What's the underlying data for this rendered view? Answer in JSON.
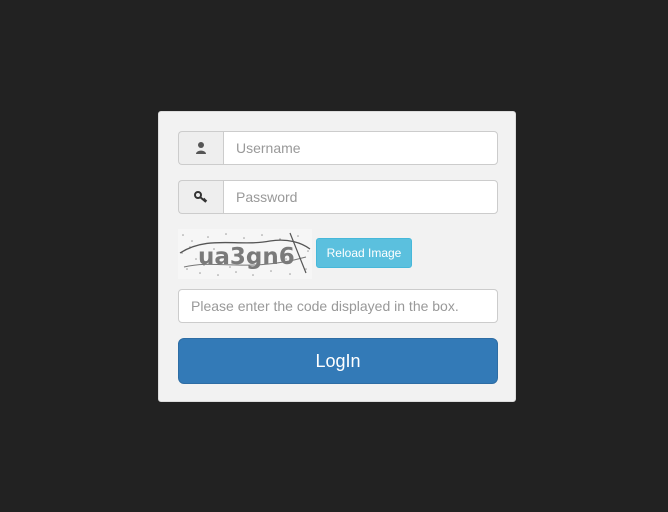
{
  "form": {
    "username_placeholder": "Username",
    "password_placeholder": "Password",
    "captcha_text": "ua3gn6",
    "reload_label": "Reload Image",
    "code_placeholder": "Please enter the code displayed in the box.",
    "login_label": "LogIn"
  },
  "icons": {
    "username": "user-icon",
    "password": "key-icon"
  },
  "colors": {
    "background": "#222222",
    "panel": "#f2f2f2",
    "reload_button": "#5bc0de",
    "login_button": "#337ab7"
  }
}
